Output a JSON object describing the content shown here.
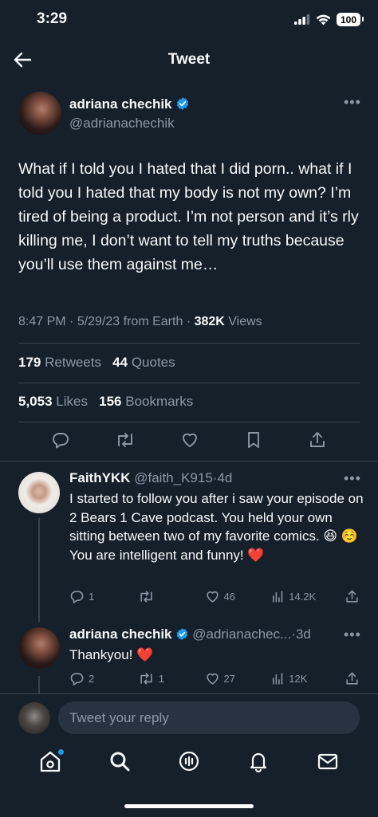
{
  "status_bar": {
    "time": "3:29",
    "battery": "100"
  },
  "header": {
    "title": "Tweet"
  },
  "tweet": {
    "author_name": "adriana chechik",
    "author_handle": "@adrianachechik",
    "text": "What if I told you I hated that I did porn.. what if I told you I hated that my body is not my own? I’m tired of being a product. I’m not person and it’s rly killing me, I don’t want to tell my truths because you’ll use them against me…",
    "time": "8:47 PM",
    "date": "5/29/23",
    "source": "from Earth",
    "views_count": "382K",
    "views_label": "Views",
    "retweets_count": "179",
    "retweets_label": "Retweets",
    "quotes_count": "44",
    "quotes_label": "Quotes",
    "likes_count": "5,053",
    "likes_label": "Likes",
    "bookmarks_count": "156",
    "bookmarks_label": "Bookmarks"
  },
  "replies": [
    {
      "name": "FaithYKK",
      "handle": "@faith_K915",
      "age": "4d",
      "text": "I started to follow you after i saw your episode on 2 Bears 1 Cave podcast. You held your own sitting between two of my favorite comics. 😆 ☺️ You are intelligent and funny! ❤️",
      "reply_count": "1",
      "retweet_count": "",
      "like_count": "46",
      "view_count": "14.2K"
    },
    {
      "name": "adriana chechik",
      "handle": "@adrianachec...",
      "age": "3d",
      "text": "Thankyou! ❤️",
      "reply_count": "2",
      "retweet_count": "1",
      "like_count": "27",
      "view_count": "12K"
    }
  ],
  "composer": {
    "placeholder": "Tweet your reply"
  },
  "colors": {
    "background": "#15202b",
    "accent": "#1d9bf0",
    "muted": "#8b98a5",
    "divider": "#38444d"
  },
  "icons": [
    "back-arrow-icon",
    "verified-icon",
    "more-icon",
    "reply-icon",
    "retweet-icon",
    "like-icon",
    "bookmark-icon",
    "share-icon",
    "views-icon",
    "home-icon",
    "search-icon",
    "spaces-icon",
    "notifications-icon",
    "messages-icon"
  ]
}
